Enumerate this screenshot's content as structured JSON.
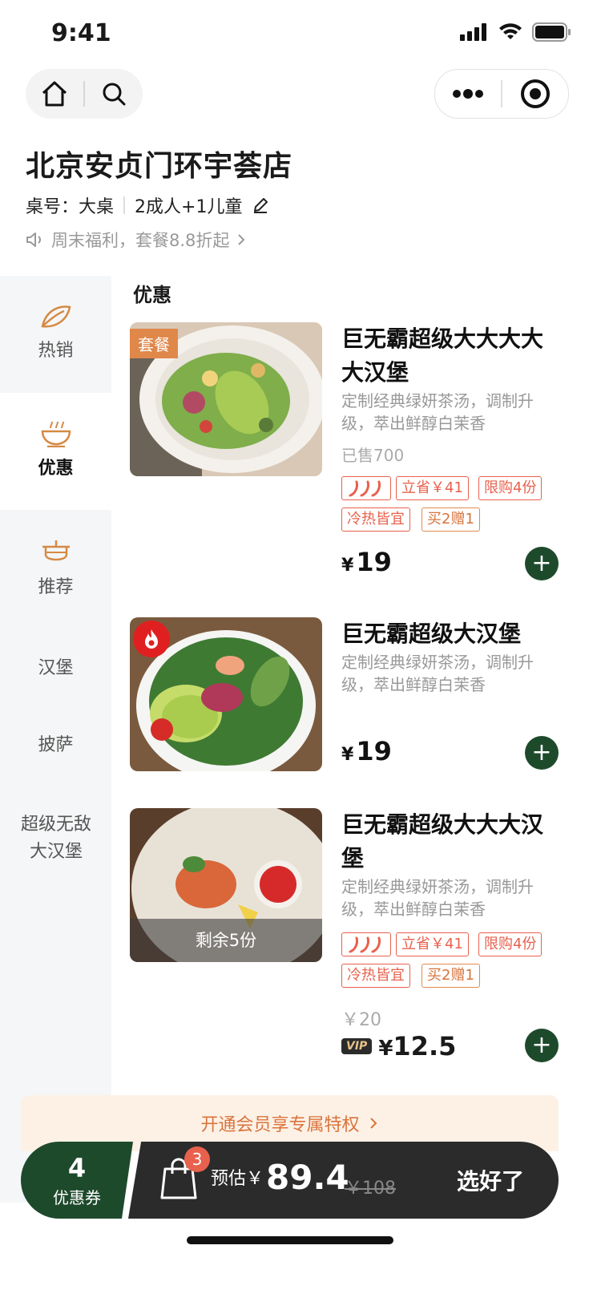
{
  "status": {
    "time": "9:41"
  },
  "store": {
    "name": "北京安贞门环宇荟店",
    "table_label": "桌号：大桌",
    "party": "2成人+1儿童",
    "notice": "周末福利，套餐8.8折起"
  },
  "sidebar": {
    "items": [
      {
        "label": "热销",
        "icon": "leaf-icon"
      },
      {
        "label": "优惠",
        "icon": "bowl-icon",
        "active": true
      },
      {
        "label": "推荐",
        "icon": "pot-icon"
      },
      {
        "label": "汉堡"
      },
      {
        "label": "披萨"
      },
      {
        "label": "超级无敌大汉堡"
      }
    ]
  },
  "section": {
    "title": "优惠"
  },
  "products": [
    {
      "badge": "套餐",
      "title": "巨无霸超级大大大大大汉堡",
      "desc": "定制经典绿妍茶汤，调制升级，萃出鲜醇白茉香",
      "sold": "已售700",
      "tags": [
        "立省￥41",
        "限购4份",
        "冷热皆宜",
        "买2赠1"
      ],
      "price": "19"
    },
    {
      "title": "巨无霸超级大汉堡",
      "desc": "定制经典绿妍茶汤，调制升级，萃出鲜醇白茉香",
      "price": "19"
    },
    {
      "remaining": "剩余5份",
      "title": "巨无霸超级大大大汉堡",
      "desc": "定制经典绿妍茶汤，调制升级，萃出鲜醇白茉香",
      "tags": [
        "立省￥41",
        "限购4份",
        "冷热皆宜",
        "买2赠1"
      ],
      "orig_price": "￥20",
      "vip_badge": "VIP",
      "vip_price": "12.5"
    }
  ],
  "currency": "¥",
  "member": {
    "label": "开通会员享专属特权"
  },
  "cart": {
    "coupon_count": "4",
    "coupon_label": "优惠券",
    "item_count": "3",
    "estimate_label": "预估￥",
    "total": "89.4",
    "original": "￥108",
    "checkout": "选好了"
  },
  "colors": {
    "brand_green": "#1e4a2c",
    "accent_orange": "#e0874a",
    "tag_red": "#e8614d"
  }
}
